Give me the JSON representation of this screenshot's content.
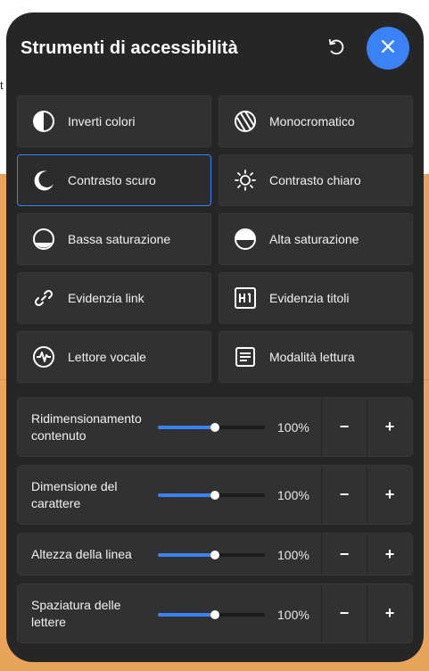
{
  "background": {
    "partial_text": "t",
    "colors": {
      "orange": "#e8a45a",
      "panel": "#262626",
      "accent": "#3b82f6"
    }
  },
  "panel": {
    "title": "Strumenti di accessibilità",
    "reset_icon": "reset-icon",
    "close_icon": "close-icon"
  },
  "tiles": [
    {
      "label": "Inverti colori",
      "icon": "invert-colors-icon",
      "active": false
    },
    {
      "label": "Monocromatico",
      "icon": "monochrome-icon",
      "active": false
    },
    {
      "label": "Contrasto scuro",
      "icon": "moon-icon",
      "active": true
    },
    {
      "label": "Contrasto chiaro",
      "icon": "sun-icon",
      "active": false
    },
    {
      "label": "Bassa saturazione",
      "icon": "low-saturation-icon",
      "active": false
    },
    {
      "label": "Alta saturazione",
      "icon": "high-saturation-icon",
      "active": false
    },
    {
      "label": "Evidenzia link",
      "icon": "link-icon",
      "active": false
    },
    {
      "label": "Evidenzia titoli",
      "icon": "heading-icon",
      "active": false
    },
    {
      "label": "Lettore vocale",
      "icon": "voice-reader-icon",
      "active": false
    },
    {
      "label": "Modalità lettura",
      "icon": "reading-mode-icon",
      "active": false
    }
  ],
  "sliders": [
    {
      "label_line1": "Ridimensionamento",
      "label_line2": "contenuto",
      "value": "100%",
      "level": 0.53,
      "minus": "−",
      "plus": "+"
    },
    {
      "label_line1": "Dimensione del",
      "label_line2": "carattere",
      "value": "100%",
      "level": 0.53,
      "minus": "−",
      "plus": "+"
    },
    {
      "label_line1": "Altezza della linea",
      "label_line2": "",
      "value": "100%",
      "level": 0.53,
      "minus": "−",
      "plus": "+"
    },
    {
      "label_line1": "Spaziatura delle",
      "label_line2": "lettere",
      "value": "100%",
      "level": 0.53,
      "minus": "−",
      "plus": "+"
    }
  ]
}
